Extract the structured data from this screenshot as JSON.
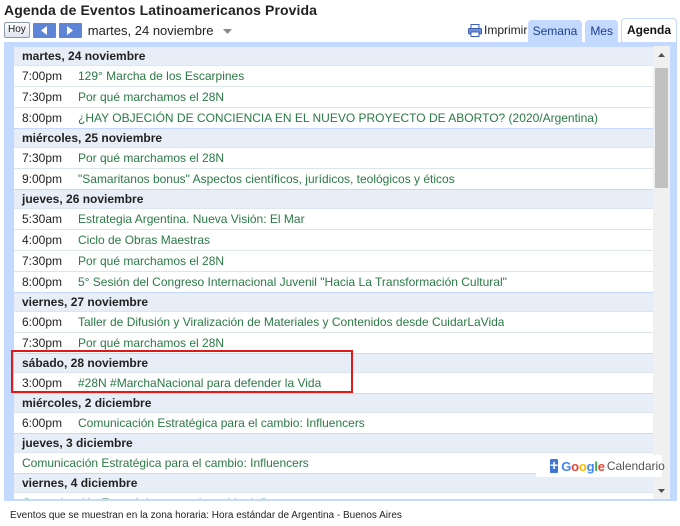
{
  "header": {
    "title": "Agenda de Eventos Latinoamericanos Provida",
    "today_label": "Hoy",
    "current_date": "martes, 24 noviembre",
    "print_label": "Imprimir",
    "tabs": [
      {
        "label": "Semana",
        "active": false
      },
      {
        "label": "Mes",
        "active": false
      },
      {
        "label": "Agenda",
        "active": true
      }
    ]
  },
  "agenda": [
    {
      "date": "martes, 24 noviembre",
      "events": [
        {
          "time": "7:00pm",
          "title": "129° Marcha de los Escarpines"
        },
        {
          "time": "7:30pm",
          "title": "Por qué marchamos el 28N"
        },
        {
          "time": "8:00pm",
          "title": "¿HAY OBJECIÓN DE CONCIENCIA EN EL NUEVO PROYECTO DE ABORTO? (2020/Argentina)"
        }
      ]
    },
    {
      "date": "miércoles, 25 noviembre",
      "events": [
        {
          "time": "7:30pm",
          "title": "Por qué marchamos el 28N"
        },
        {
          "time": "9:00pm",
          "title": "\"Samaritanos bonus\" Aspectos científicos, jurídicos, teológicos y éticos"
        }
      ]
    },
    {
      "date": "jueves, 26 noviembre",
      "events": [
        {
          "time": "5:30am",
          "title": "Estrategia Argentina. Nueva Visión: El Mar"
        },
        {
          "time": "4:00pm",
          "title": "Ciclo de Obras Maestras"
        },
        {
          "time": "7:30pm",
          "title": "Por qué marchamos el 28N"
        },
        {
          "time": "8:00pm",
          "title": "5° Sesión del Congreso Internacional Juvenil \"Hacia La Transformación Cultural\""
        }
      ]
    },
    {
      "date": "viernes, 27 noviembre",
      "events": [
        {
          "time": "6:00pm",
          "title": "Taller de Difusión y Viralización de Materiales y Contenidos desde CuidarLaVida"
        },
        {
          "time": "7:30pm",
          "title": "Por qué marchamos el 28N"
        }
      ]
    },
    {
      "date": "sábado, 28 noviembre",
      "events": [
        {
          "time": "3:00pm",
          "title": "#28N #MarchaNacional para defender la Vida"
        }
      ]
    },
    {
      "date": "miércoles, 2 diciembre",
      "events": [
        {
          "time": "6:00pm",
          "title": "Comunicación Estratégica para el cambio: Influencers"
        }
      ]
    },
    {
      "date": "jueves, 3 diciembre",
      "events": [
        {
          "time": "",
          "title": "Comunicación Estratégica para el cambio: Influencers"
        }
      ]
    },
    {
      "date": "viernes, 4 diciembre",
      "events": [
        {
          "time": "",
          "title": "Comunicación Estratégica para el cambio: Influencers"
        }
      ]
    }
  ],
  "badge": {
    "brand_g1": "G",
    "brand_o1": "o",
    "brand_o2": "o",
    "brand_g2": "g",
    "brand_l": "l",
    "brand_e": "e",
    "label": "Calendario"
  },
  "footer": {
    "timezone_note": "Eventos que se muestran en la zona horaria: Hora estándar de Argentina - Buenos Aires"
  },
  "colors": {
    "event_link": "#2a7a45",
    "day_header_bg": "#e8eef7",
    "frame": "#c3d9ff",
    "nav_button": "#5d84d6",
    "highlight": "#e01a1a"
  }
}
